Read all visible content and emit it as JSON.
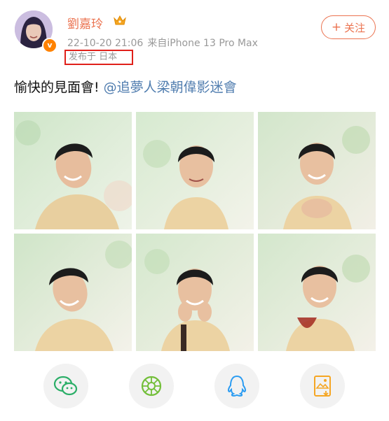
{
  "post": {
    "username": "劉嘉玲",
    "timestamp": "22-10-20 21:06",
    "source": "来自iPhone 13 Pro Max",
    "location": "发布于 日本",
    "text": "愉快的見面會!",
    "mention": "@追夢人梁朝偉影迷會"
  },
  "follow_button": {
    "label": "+关注",
    "plus": "+",
    "text": "关注"
  },
  "colors": {
    "accent": "#eb7350",
    "link": "#507daf",
    "highlight_box": "#e0201a",
    "verified": "#ff8200"
  },
  "photos": [
    {
      "name": "photo-1",
      "pose": "smile-head-tilt-left"
    },
    {
      "name": "photo-2",
      "pose": "gentle-smile"
    },
    {
      "name": "photo-3",
      "pose": "hands-together"
    },
    {
      "name": "photo-4",
      "pose": "laughing-tilt"
    },
    {
      "name": "photo-5",
      "pose": "chin-on-hands"
    },
    {
      "name": "photo-6",
      "pose": "holding-wine-glass"
    }
  ],
  "share_actions": [
    {
      "name": "wechat-share-button",
      "icon": "wechat-icon"
    },
    {
      "name": "moments-share-button",
      "icon": "moments-icon"
    },
    {
      "name": "qq-share-button",
      "icon": "qq-icon"
    },
    {
      "name": "save-image-button",
      "icon": "save-image-icon"
    }
  ]
}
